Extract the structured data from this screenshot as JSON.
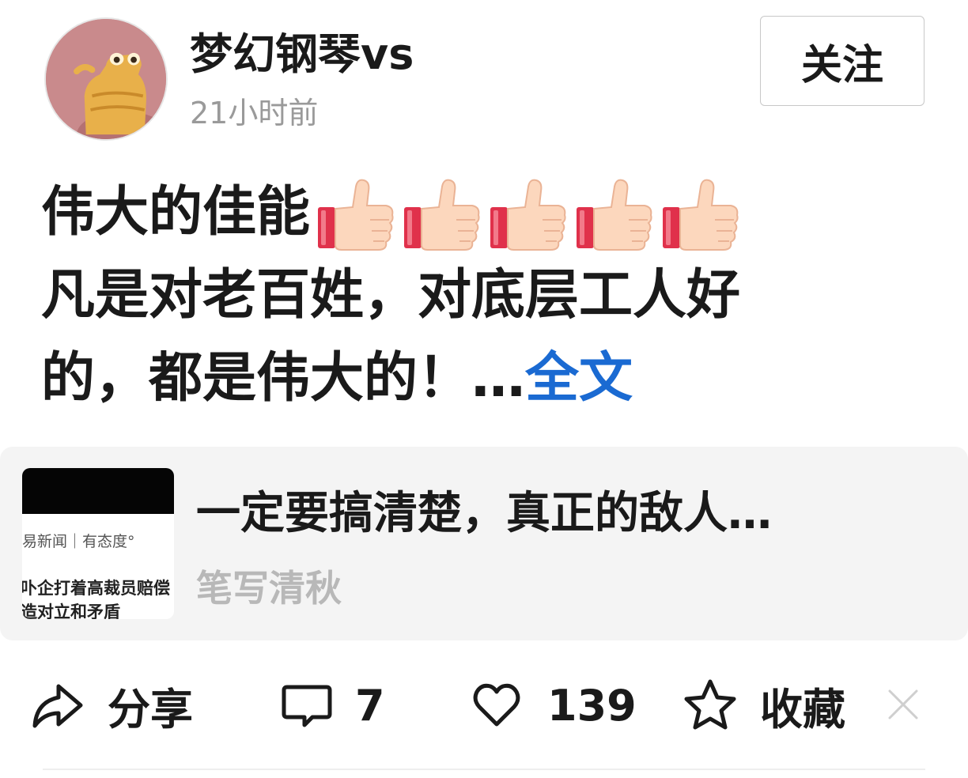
{
  "header": {
    "username": "梦幻钢琴vs",
    "timestamp": "21小时前",
    "follow_label": "关注"
  },
  "post": {
    "line1": "伟大的佳能",
    "thumbs_emoji_count": 5,
    "line2": "凡是对老百姓，对底层工人好",
    "line3": "的，都是伟大的！…",
    "read_more": "全文"
  },
  "card": {
    "thumbnail": {
      "source": "易新闻｜有态度°",
      "line1": "卟企打着高裁员赔偿",
      "line2": "造对立和矛盾"
    },
    "title": "一定要搞清楚，真正的敌人…",
    "author": "笔写清秋"
  },
  "actions": {
    "share_label": "分享",
    "comment_count": "7",
    "like_count": "139",
    "favorite_label": "收藏"
  },
  "colors": {
    "link": "#1a6ad2",
    "muted": "#9a9a9a",
    "card_bg": "#f4f4f4"
  },
  "icons": {
    "share": "share-arrow-icon",
    "comment": "comment-bubble-icon",
    "like": "heart-icon",
    "favorite": "star-icon",
    "close": "close-icon",
    "emoji": "thumbs-up-emoji"
  }
}
